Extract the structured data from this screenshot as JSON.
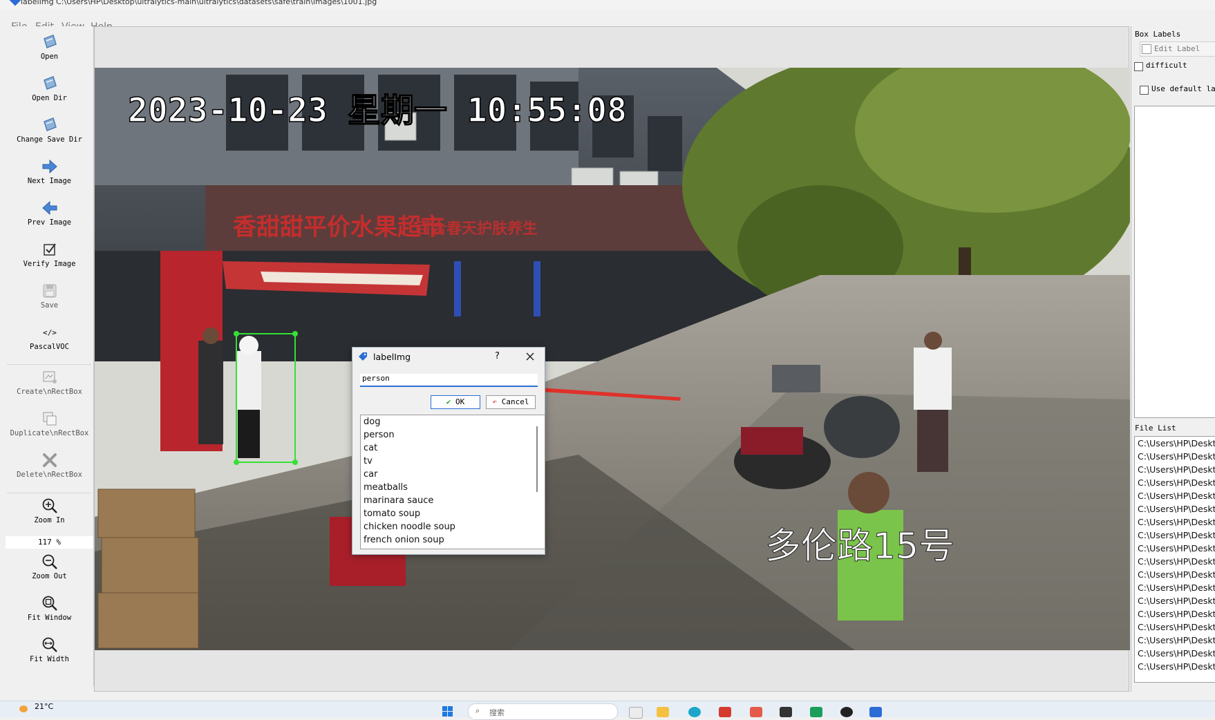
{
  "window": {
    "title": "labelImg C:\\Users\\HP\\Desktop\\ultralytics-main\\ultralytics\\datasets\\safe\\train\\images\\1001.jpg"
  },
  "menu": [
    "File",
    "Edit",
    "View",
    "Help"
  ],
  "toolbar": {
    "open": "Open",
    "open_dir": "Open Dir",
    "change_save_dir": "Change Save Dir",
    "next_image": "Next Image",
    "prev_image": "Prev Image",
    "verify_image": "Verify Image",
    "save": "Save",
    "format": "PascalVOC",
    "create_rectbox": "Create\\nRectBox",
    "duplicate_rectbox": "Duplicate\\nRectBox",
    "delete_rectbox": "Delete\\nRectBox",
    "zoom_in": "Zoom In",
    "zoom_level": "117 %",
    "zoom_out": "Zoom Out",
    "fit_window": "Fit Window",
    "fit_width": "Fit Width"
  },
  "photo": {
    "timestamp": "2023-10-23 星期一 10:55:08",
    "location": "多伦路15号",
    "shop_sign": "香甜甜平价水果超市",
    "shop_sign_2": "百合春天护肤养生"
  },
  "dialog": {
    "title": "labelImg",
    "help": "?",
    "input_value": "person",
    "ok_label": "OK",
    "cancel_label": "Cancel",
    "labels": [
      "dog",
      "person",
      "cat",
      "tv",
      "car",
      "meatballs",
      "marinara sauce",
      "tomato soup",
      "chicken noodle soup",
      "french onion soup"
    ]
  },
  "right_panel": {
    "box_labels_title": "Box Labels",
    "edit_label": "Edit Label",
    "difficult": "difficult",
    "use_default_label": "Use default lab",
    "file_list_title": "File List",
    "files": [
      "C:\\Users\\HP\\Deskto",
      "C:\\Users\\HP\\Deskto",
      "C:\\Users\\HP\\Deskto",
      "C:\\Users\\HP\\Deskto",
      "C:\\Users\\HP\\Deskto",
      "C:\\Users\\HP\\Deskto",
      "C:\\Users\\HP\\Deskto",
      "C:\\Users\\HP\\Deskto",
      "C:\\Users\\HP\\Deskto",
      "C:\\Users\\HP\\Deskto",
      "C:\\Users\\HP\\Deskto",
      "C:\\Users\\HP\\Deskto",
      "C:\\Users\\HP\\Deskto",
      "C:\\Users\\HP\\Deskto",
      "C:\\Users\\HP\\Deskto",
      "C:\\Users\\HP\\Deskto",
      "C:\\Users\\HP\\Deskto",
      "C:\\Users\\HP\\Deskto"
    ]
  },
  "taskbar": {
    "weather": "21°C",
    "search_placeholder": "搜索"
  },
  "colors": {
    "bbox": "#35e035",
    "arrow": "#e0312a",
    "accent": "#2b6cd6"
  }
}
